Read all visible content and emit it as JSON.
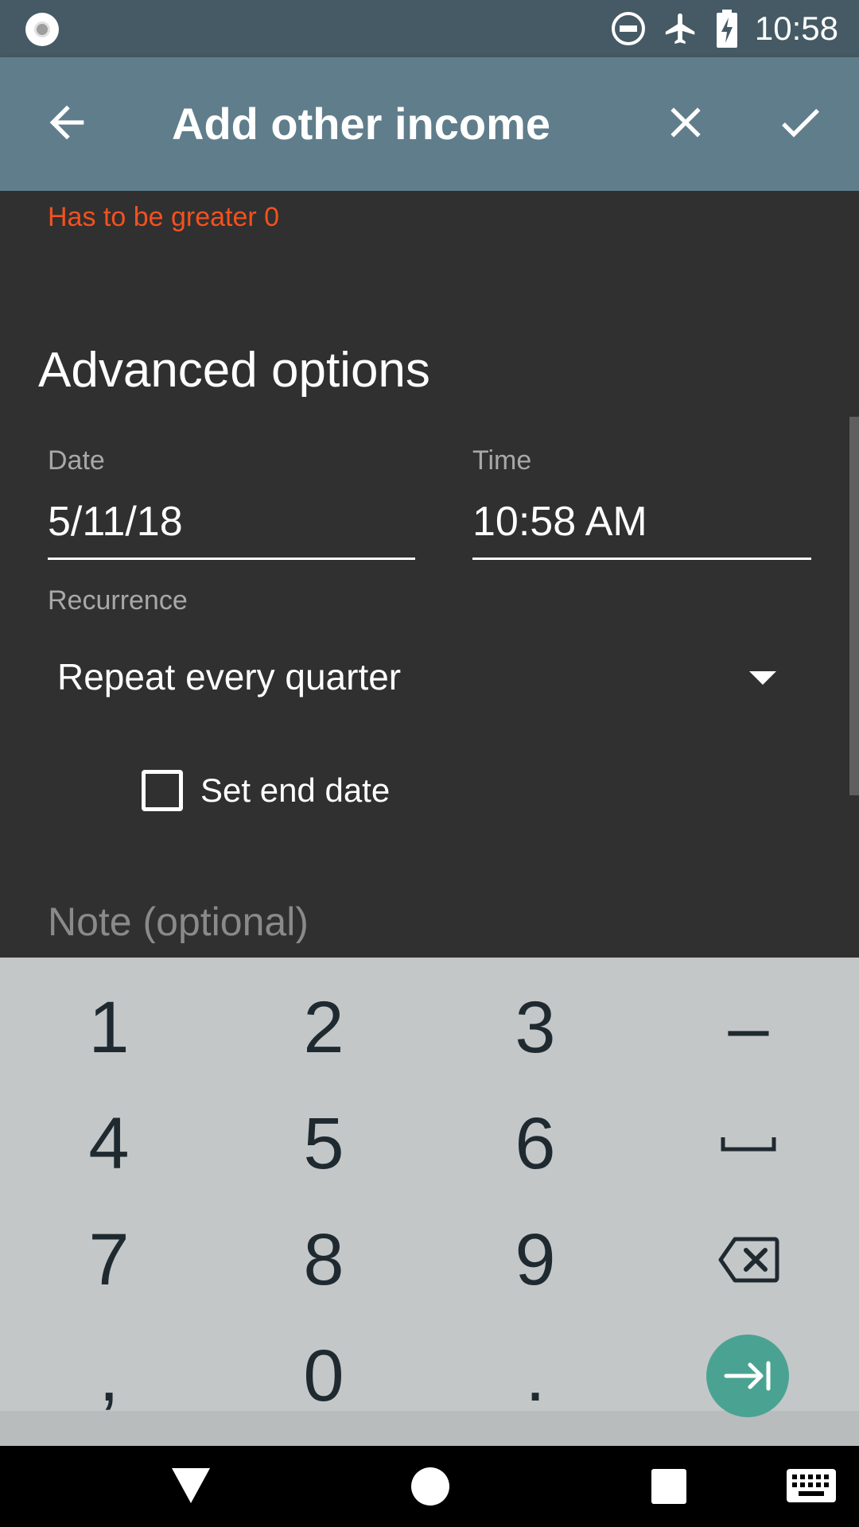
{
  "status_bar": {
    "time": "10:58",
    "icons": [
      "record-icon",
      "do-not-disturb-icon",
      "airplane-mode-icon",
      "battery-charging-icon"
    ]
  },
  "app_bar": {
    "title": "Add other income",
    "icons": [
      "back-arrow-icon",
      "close-icon",
      "checkmark-icon"
    ]
  },
  "form": {
    "error_text": "Has to be greater 0",
    "section_title": "Advanced options",
    "date": {
      "label": "Date",
      "value": "5/11/18"
    },
    "time": {
      "label": "Time",
      "value": "10:58 AM"
    },
    "recurrence": {
      "label": "Recurrence",
      "value": "Repeat every quarter"
    },
    "set_end_date": {
      "label": "Set end date",
      "checked": false
    },
    "note": {
      "placeholder": "Note (optional)"
    }
  },
  "keyboard": {
    "rows": [
      [
        "1",
        "2",
        "3",
        "–"
      ],
      [
        "4",
        "5",
        "6",
        "␣"
      ],
      [
        "7",
        "8",
        "9",
        "⌫"
      ],
      [
        ",",
        "0",
        ".",
        "⇥"
      ]
    ],
    "accent_color": "#4aa392"
  },
  "nav_bar": {
    "icons": [
      "back-triangle-icon",
      "home-circle-icon",
      "recents-square-icon",
      "keyboard-switch-icon"
    ]
  },
  "colors": {
    "status_bar": "#455a64",
    "app_bar": "#607d8b",
    "background": "#303030",
    "error": "#f4511e",
    "keyboard": "#c4c7c8"
  }
}
